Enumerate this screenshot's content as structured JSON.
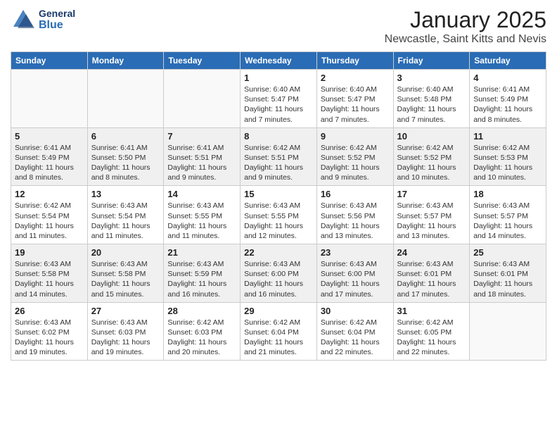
{
  "header": {
    "logo_general": "General",
    "logo_blue": "Blue",
    "month_title": "January 2025",
    "location": "Newcastle, Saint Kitts and Nevis"
  },
  "weekdays": [
    "Sunday",
    "Monday",
    "Tuesday",
    "Wednesday",
    "Thursday",
    "Friday",
    "Saturday"
  ],
  "weeks": [
    [
      {
        "day": "",
        "info": ""
      },
      {
        "day": "",
        "info": ""
      },
      {
        "day": "",
        "info": ""
      },
      {
        "day": "1",
        "info": "Sunrise: 6:40 AM\nSunset: 5:47 PM\nDaylight: 11 hours and 7 minutes."
      },
      {
        "day": "2",
        "info": "Sunrise: 6:40 AM\nSunset: 5:47 PM\nDaylight: 11 hours and 7 minutes."
      },
      {
        "day": "3",
        "info": "Sunrise: 6:40 AM\nSunset: 5:48 PM\nDaylight: 11 hours and 7 minutes."
      },
      {
        "day": "4",
        "info": "Sunrise: 6:41 AM\nSunset: 5:49 PM\nDaylight: 11 hours and 8 minutes."
      }
    ],
    [
      {
        "day": "5",
        "info": "Sunrise: 6:41 AM\nSunset: 5:49 PM\nDaylight: 11 hours and 8 minutes."
      },
      {
        "day": "6",
        "info": "Sunrise: 6:41 AM\nSunset: 5:50 PM\nDaylight: 11 hours and 8 minutes."
      },
      {
        "day": "7",
        "info": "Sunrise: 6:41 AM\nSunset: 5:51 PM\nDaylight: 11 hours and 9 minutes."
      },
      {
        "day": "8",
        "info": "Sunrise: 6:42 AM\nSunset: 5:51 PM\nDaylight: 11 hours and 9 minutes."
      },
      {
        "day": "9",
        "info": "Sunrise: 6:42 AM\nSunset: 5:52 PM\nDaylight: 11 hours and 9 minutes."
      },
      {
        "day": "10",
        "info": "Sunrise: 6:42 AM\nSunset: 5:52 PM\nDaylight: 11 hours and 10 minutes."
      },
      {
        "day": "11",
        "info": "Sunrise: 6:42 AM\nSunset: 5:53 PM\nDaylight: 11 hours and 10 minutes."
      }
    ],
    [
      {
        "day": "12",
        "info": "Sunrise: 6:42 AM\nSunset: 5:54 PM\nDaylight: 11 hours and 11 minutes."
      },
      {
        "day": "13",
        "info": "Sunrise: 6:43 AM\nSunset: 5:54 PM\nDaylight: 11 hours and 11 minutes."
      },
      {
        "day": "14",
        "info": "Sunrise: 6:43 AM\nSunset: 5:55 PM\nDaylight: 11 hours and 11 minutes."
      },
      {
        "day": "15",
        "info": "Sunrise: 6:43 AM\nSunset: 5:55 PM\nDaylight: 11 hours and 12 minutes."
      },
      {
        "day": "16",
        "info": "Sunrise: 6:43 AM\nSunset: 5:56 PM\nDaylight: 11 hours and 13 minutes."
      },
      {
        "day": "17",
        "info": "Sunrise: 6:43 AM\nSunset: 5:57 PM\nDaylight: 11 hours and 13 minutes."
      },
      {
        "day": "18",
        "info": "Sunrise: 6:43 AM\nSunset: 5:57 PM\nDaylight: 11 hours and 14 minutes."
      }
    ],
    [
      {
        "day": "19",
        "info": "Sunrise: 6:43 AM\nSunset: 5:58 PM\nDaylight: 11 hours and 14 minutes."
      },
      {
        "day": "20",
        "info": "Sunrise: 6:43 AM\nSunset: 5:58 PM\nDaylight: 11 hours and 15 minutes."
      },
      {
        "day": "21",
        "info": "Sunrise: 6:43 AM\nSunset: 5:59 PM\nDaylight: 11 hours and 16 minutes."
      },
      {
        "day": "22",
        "info": "Sunrise: 6:43 AM\nSunset: 6:00 PM\nDaylight: 11 hours and 16 minutes."
      },
      {
        "day": "23",
        "info": "Sunrise: 6:43 AM\nSunset: 6:00 PM\nDaylight: 11 hours and 17 minutes."
      },
      {
        "day": "24",
        "info": "Sunrise: 6:43 AM\nSunset: 6:01 PM\nDaylight: 11 hours and 17 minutes."
      },
      {
        "day": "25",
        "info": "Sunrise: 6:43 AM\nSunset: 6:01 PM\nDaylight: 11 hours and 18 minutes."
      }
    ],
    [
      {
        "day": "26",
        "info": "Sunrise: 6:43 AM\nSunset: 6:02 PM\nDaylight: 11 hours and 19 minutes."
      },
      {
        "day": "27",
        "info": "Sunrise: 6:43 AM\nSunset: 6:03 PM\nDaylight: 11 hours and 19 minutes."
      },
      {
        "day": "28",
        "info": "Sunrise: 6:42 AM\nSunset: 6:03 PM\nDaylight: 11 hours and 20 minutes."
      },
      {
        "day": "29",
        "info": "Sunrise: 6:42 AM\nSunset: 6:04 PM\nDaylight: 11 hours and 21 minutes."
      },
      {
        "day": "30",
        "info": "Sunrise: 6:42 AM\nSunset: 6:04 PM\nDaylight: 11 hours and 22 minutes."
      },
      {
        "day": "31",
        "info": "Sunrise: 6:42 AM\nSunset: 6:05 PM\nDaylight: 11 hours and 22 minutes."
      },
      {
        "day": "",
        "info": ""
      }
    ]
  ]
}
